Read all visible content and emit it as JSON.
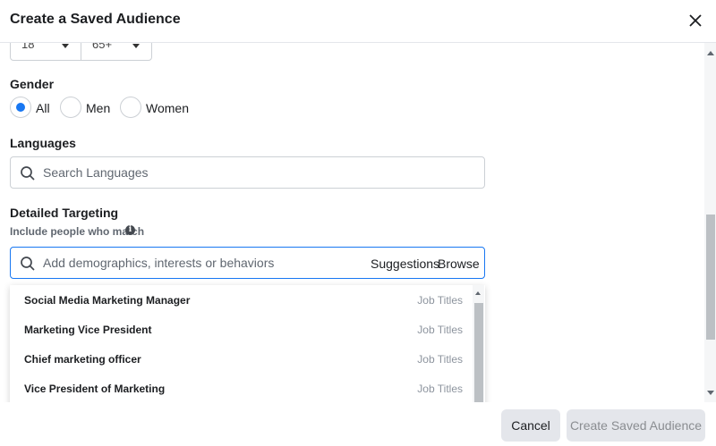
{
  "dialog": {
    "title": "Create a Saved Audience"
  },
  "age": {
    "min": "18",
    "max": "65+"
  },
  "gender": {
    "label": "Gender",
    "options": [
      {
        "label": "All",
        "checked": true
      },
      {
        "label": "Men",
        "checked": false
      },
      {
        "label": "Women",
        "checked": false
      }
    ]
  },
  "languages": {
    "label": "Languages",
    "placeholder": "Search Languages"
  },
  "detailed_targeting": {
    "label": "Detailed Targeting",
    "sublabel": "Include people who match",
    "placeholder": "Add demographics, interests or behaviors",
    "suggestions_label": "Suggestions",
    "browse_label": "Browse",
    "results": [
      {
        "name": "Social Media Marketing Manager",
        "type": "Job Titles"
      },
      {
        "name": "Marketing Vice President",
        "type": "Job Titles"
      },
      {
        "name": "Chief marketing officer",
        "type": "Job Titles"
      },
      {
        "name": "Vice President of Marketing",
        "type": "Job Titles"
      }
    ]
  },
  "footer": {
    "cancel_label": "Cancel",
    "create_label": "Create Saved Audience"
  },
  "colors": {
    "accent": "#1877f2",
    "text": "#1c1e21",
    "muted": "#606770",
    "button_bg": "#e4e6eb"
  }
}
